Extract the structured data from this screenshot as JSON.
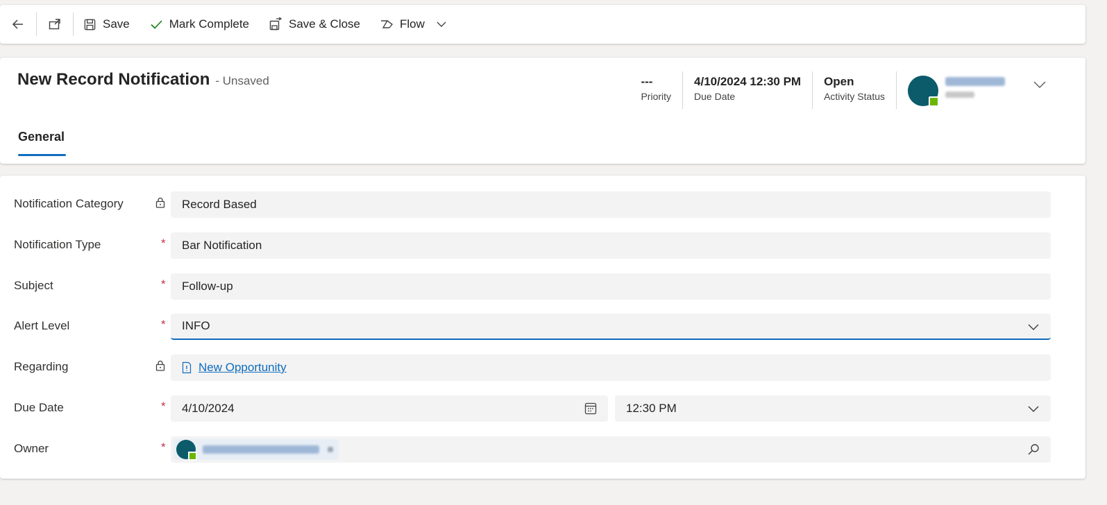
{
  "commandbar": {
    "save_label": "Save",
    "mark_complete_label": "Mark Complete",
    "save_close_label": "Save & Close",
    "flow_label": "Flow"
  },
  "header": {
    "title": "New Record Notification",
    "status": "- Unsaved",
    "fields": [
      {
        "value": "---",
        "label": "Priority"
      },
      {
        "value": "4/10/2024 12:30 PM",
        "label": "Due Date"
      },
      {
        "value": "Open",
        "label": "Activity Status"
      }
    ]
  },
  "tabs": [
    {
      "label": "General",
      "selected": true
    }
  ],
  "form": {
    "notification_category": {
      "label": "Notification Category",
      "value": "Record Based"
    },
    "notification_type": {
      "label": "Notification Type",
      "value": "Bar Notification"
    },
    "subject": {
      "label": "Subject",
      "value": "Follow-up"
    },
    "alert_level": {
      "label": "Alert Level",
      "value": "INFO"
    },
    "regarding": {
      "label": "Regarding",
      "value": "New Opportunity"
    },
    "due_date": {
      "label": "Due Date",
      "date": "4/10/2024",
      "time": "12:30 PM"
    },
    "owner": {
      "label": "Owner"
    }
  },
  "colors": {
    "accent": "#0f6cbd",
    "required": "#c4314b",
    "avatar": "#0b5b6b",
    "presence": "#6bb700"
  }
}
